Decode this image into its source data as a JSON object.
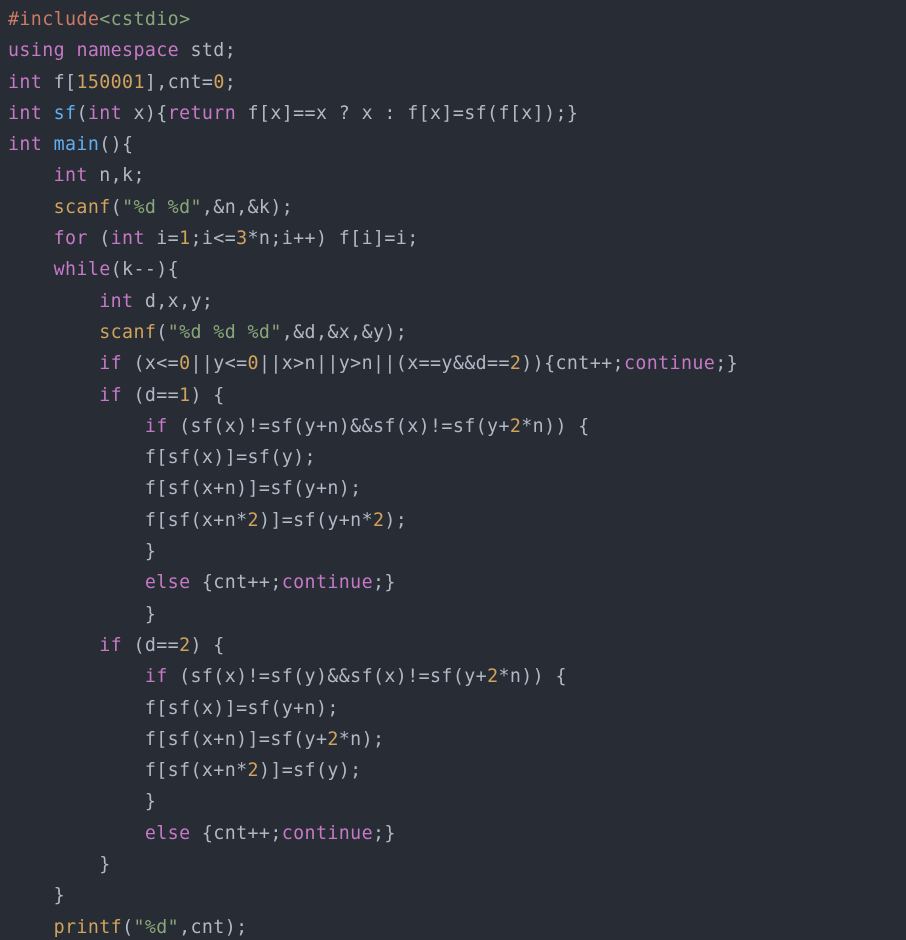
{
  "code": {
    "language": "cpp",
    "tokens": [
      [
        [
          "pre",
          "#include"
        ],
        [
          "inc",
          "<cstdio>"
        ]
      ],
      [
        [
          "kw",
          "using"
        ],
        [
          "id",
          " "
        ],
        [
          "kw",
          "namespace"
        ],
        [
          "id",
          " std;"
        ]
      ],
      [
        [
          "type",
          "int"
        ],
        [
          "id",
          " f["
        ],
        [
          "num",
          "150001"
        ],
        [
          "id",
          "],cnt="
        ],
        [
          "num",
          "0"
        ],
        [
          "id",
          ";"
        ]
      ],
      [
        [
          "type",
          "int"
        ],
        [
          "id",
          " "
        ],
        [
          "fn",
          "sf"
        ],
        [
          "id",
          "("
        ],
        [
          "type",
          "int"
        ],
        [
          "id",
          " x){"
        ],
        [
          "kw",
          "return"
        ],
        [
          "id",
          " f[x]==x ? x : f[x]=sf(f[x]);}"
        ]
      ],
      [
        [
          "type",
          "int"
        ],
        [
          "id",
          " "
        ],
        [
          "fn",
          "main"
        ],
        [
          "id",
          "(){"
        ]
      ],
      [
        [
          "id",
          "    "
        ],
        [
          "type",
          "int"
        ],
        [
          "id",
          " n,k;"
        ]
      ],
      [
        [
          "id",
          "    "
        ],
        [
          "call",
          "scanf"
        ],
        [
          "id",
          "("
        ],
        [
          "str",
          "\"%d %d\""
        ],
        [
          "id",
          ",&n,&k);"
        ]
      ],
      [
        [
          "id",
          "    "
        ],
        [
          "kw",
          "for"
        ],
        [
          "id",
          " ("
        ],
        [
          "type",
          "int"
        ],
        [
          "id",
          " i="
        ],
        [
          "num",
          "1"
        ],
        [
          "id",
          ";i<="
        ],
        [
          "num",
          "3"
        ],
        [
          "id",
          "*n;i++) f[i]=i;"
        ]
      ],
      [
        [
          "id",
          "    "
        ],
        [
          "kw",
          "while"
        ],
        [
          "id",
          "(k--){"
        ]
      ],
      [
        [
          "id",
          "        "
        ],
        [
          "type",
          "int"
        ],
        [
          "id",
          " d,x,y;"
        ]
      ],
      [
        [
          "id",
          "        "
        ],
        [
          "call",
          "scanf"
        ],
        [
          "id",
          "("
        ],
        [
          "str",
          "\"%d %d %d\""
        ],
        [
          "id",
          ",&d,&x,&y);"
        ]
      ],
      [
        [
          "id",
          "        "
        ],
        [
          "kw",
          "if"
        ],
        [
          "id",
          " (x<="
        ],
        [
          "num",
          "0"
        ],
        [
          "id",
          "||y<="
        ],
        [
          "num",
          "0"
        ],
        [
          "id",
          "||x>n||y>n||(x==y&&d=="
        ],
        [
          "num",
          "2"
        ],
        [
          "id",
          ")){cnt++;"
        ],
        [
          "kw",
          "continue"
        ],
        [
          "id",
          ";}"
        ]
      ],
      [
        [
          "id",
          "        "
        ],
        [
          "kw",
          "if"
        ],
        [
          "id",
          " (d=="
        ],
        [
          "num",
          "1"
        ],
        [
          "id",
          ") {"
        ]
      ],
      [
        [
          "id",
          "            "
        ],
        [
          "kw",
          "if"
        ],
        [
          "id",
          " (sf(x)!=sf(y+n)&&sf(x)!=sf(y+"
        ],
        [
          "num",
          "2"
        ],
        [
          "id",
          "*n)) {"
        ]
      ],
      [
        [
          "id",
          "            f[sf(x)]=sf(y);"
        ]
      ],
      [
        [
          "id",
          "            f[sf(x+n)]=sf(y+n);"
        ]
      ],
      [
        [
          "id",
          "            f[sf(x+n*"
        ],
        [
          "num",
          "2"
        ],
        [
          "id",
          ")]=sf(y+n*"
        ],
        [
          "num",
          "2"
        ],
        [
          "id",
          ");"
        ]
      ],
      [
        [
          "id",
          "            }"
        ]
      ],
      [
        [
          "id",
          "            "
        ],
        [
          "kw",
          "else"
        ],
        [
          "id",
          " {cnt++;"
        ],
        [
          "kw",
          "continue"
        ],
        [
          "id",
          ";}"
        ]
      ],
      [
        [
          "id",
          "            }"
        ]
      ],
      [
        [
          "id",
          "        "
        ],
        [
          "kw",
          "if"
        ],
        [
          "id",
          " (d=="
        ],
        [
          "num",
          "2"
        ],
        [
          "id",
          ") {"
        ]
      ],
      [
        [
          "id",
          "            "
        ],
        [
          "kw",
          "if"
        ],
        [
          "id",
          " (sf(x)!=sf(y)&&sf(x)!=sf(y+"
        ],
        [
          "num",
          "2"
        ],
        [
          "id",
          "*n)) {"
        ]
      ],
      [
        [
          "id",
          "            f[sf(x)]=sf(y+n);"
        ]
      ],
      [
        [
          "id",
          "            f[sf(x+n)]=sf(y+"
        ],
        [
          "num",
          "2"
        ],
        [
          "id",
          "*n);"
        ]
      ],
      [
        [
          "id",
          "            f[sf(x+n*"
        ],
        [
          "num",
          "2"
        ],
        [
          "id",
          ")]=sf(y);"
        ]
      ],
      [
        [
          "id",
          "            }"
        ]
      ],
      [
        [
          "id",
          "            "
        ],
        [
          "kw",
          "else"
        ],
        [
          "id",
          " {cnt++;"
        ],
        [
          "kw",
          "continue"
        ],
        [
          "id",
          ";}"
        ]
      ],
      [
        [
          "id",
          "        }"
        ]
      ],
      [
        [
          "id",
          "    }"
        ]
      ],
      [
        [
          "id",
          "    "
        ],
        [
          "call",
          "printf"
        ],
        [
          "id",
          "("
        ],
        [
          "str",
          "\"%d\""
        ],
        [
          "id",
          ",cnt);"
        ]
      ]
    ]
  }
}
